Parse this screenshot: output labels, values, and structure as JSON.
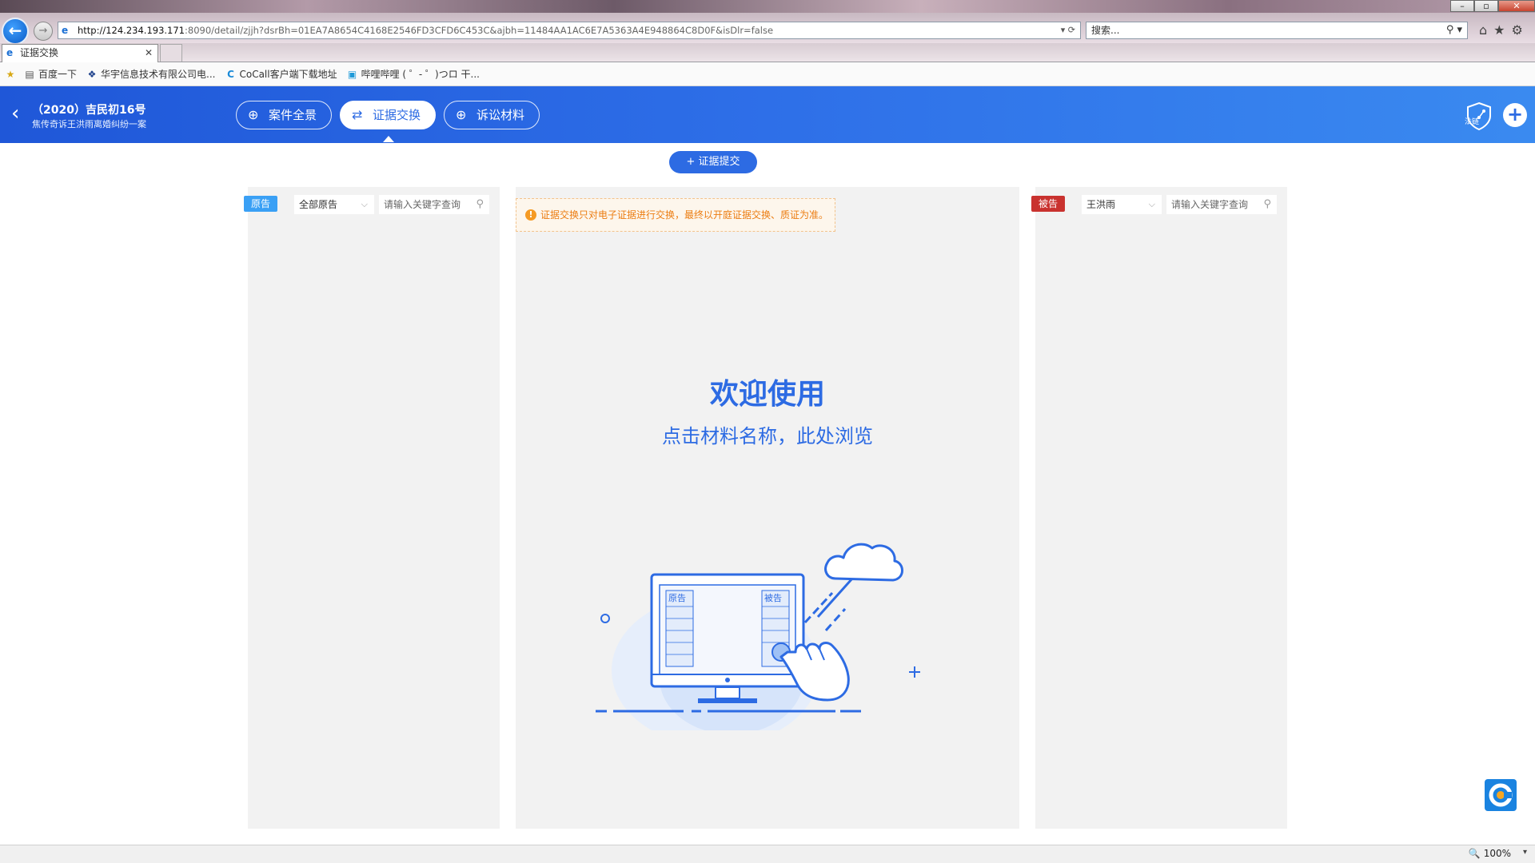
{
  "browser": {
    "url_host": "http://124.234.193.171",
    "url_rest": ":8090/detail/zjjh?dsrBh=01EA7A8654C4168E2546FD3CFD6C453C&ajbh=11484AA1AC6E7A5363A4E948864C8D0F&isDlr=false",
    "search_placeholder": "搜索...",
    "tab_title": "证据交换",
    "favorites": [
      "百度一下",
      "华宇信息技术有限公司电...",
      "CoCall客户端下载地址",
      "哔哩哔哩 ( ゜- ゜)つロ 干..."
    ],
    "zoom": "100%"
  },
  "header": {
    "case_number": "（2020）吉民初16号",
    "case_desc": "焦传奇诉王洪雨离婚纠纷一案",
    "tabs": [
      {
        "label": "案件全景"
      },
      {
        "label": "证据交换"
      },
      {
        "label": "诉讼材料"
      }
    ],
    "shield_label": "法链"
  },
  "actions": {
    "submit_label": "+ 证据提交"
  },
  "left_panel": {
    "badge": "原告",
    "select_value": "全部原告",
    "search_placeholder": "请输入关键字查询"
  },
  "center_panel": {
    "notice": "证据交换只对电子证据进行交换，最终以开庭证据交换、质证为准。",
    "welcome_title": "欢迎使用",
    "welcome_sub": "点击材料名称，此处浏览",
    "illus_left_label": "原告",
    "illus_right_label": "被告"
  },
  "right_panel": {
    "badge": "被告",
    "select_value": "王洪雨",
    "search_placeholder": "请输入关键字查询"
  },
  "colors": {
    "primary": "#2d6be3",
    "plaintiff": "#3aa0f5",
    "defendant": "#c9322f",
    "notice": "#ec7d12"
  }
}
